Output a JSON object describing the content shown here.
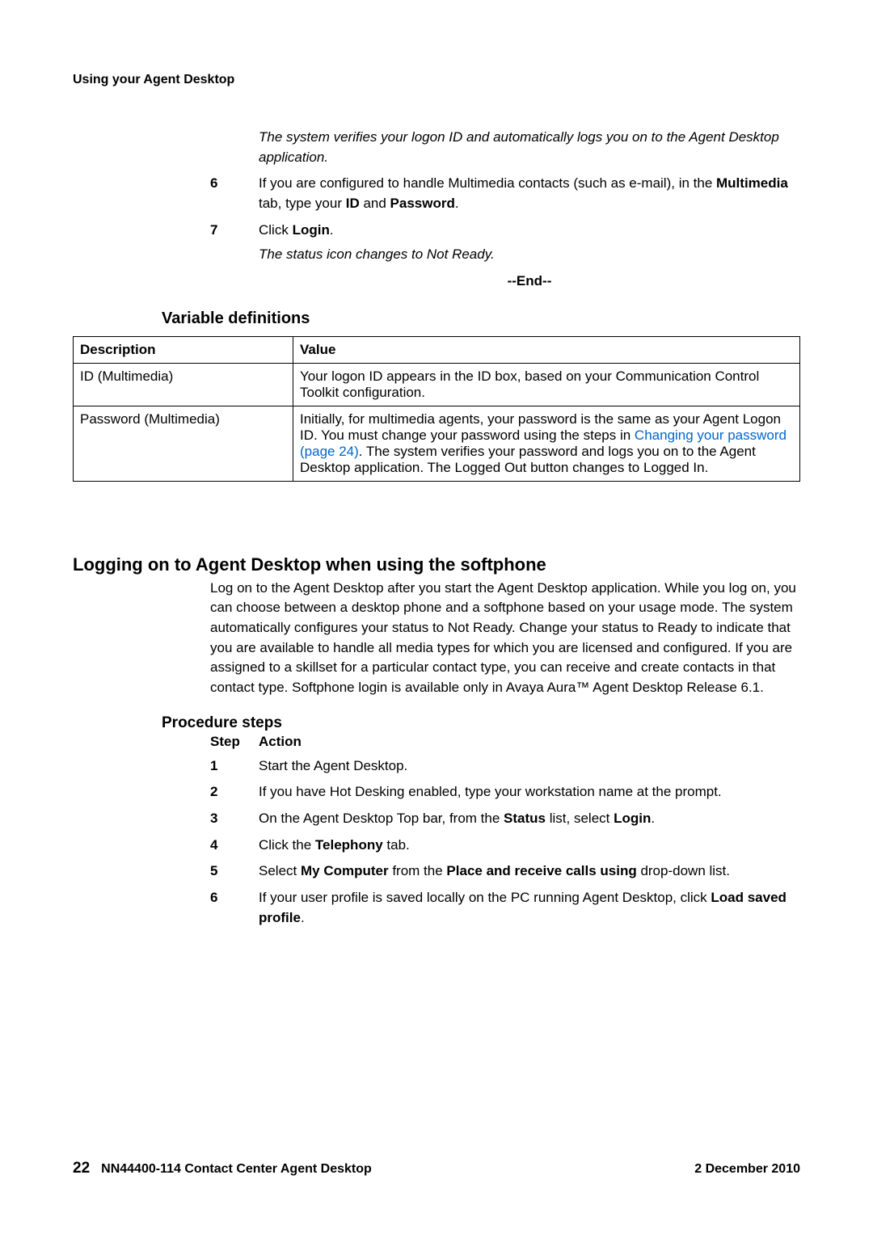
{
  "runningHead": "Using your Agent Desktop",
  "topResult": "The system verifies your logon ID and automatically logs you on to the Agent Desktop application.",
  "steps_top": [
    {
      "num": "6",
      "parts": [
        {
          "t": "If you are configured to handle Multimedia contacts (such as e-mail), in the "
        },
        {
          "t": "Multimedia",
          "b": true
        },
        {
          "t": " tab, type your "
        },
        {
          "t": "ID",
          "b": true
        },
        {
          "t": " and "
        },
        {
          "t": "Password",
          "b": true
        },
        {
          "t": "."
        }
      ]
    },
    {
      "num": "7",
      "parts": [
        {
          "t": "Click "
        },
        {
          "t": "Login",
          "b": true
        },
        {
          "t": "."
        }
      ],
      "result": "The status icon changes to Not Ready."
    }
  ],
  "endMarker": "--End--",
  "varDefHeading": "Variable definitions",
  "table": {
    "headers": [
      "Description",
      "Value"
    ],
    "rows": [
      {
        "desc": "ID (Multimedia)",
        "value_parts": [
          {
            "t": "Your logon ID appears in the ID box, based on your Communication Control Toolkit configuration."
          }
        ]
      },
      {
        "desc": "Password (Multimedia)",
        "value_parts": [
          {
            "t": "Initially, for multimedia agents, your password is the same as your Agent Logon ID. You must change your password using the steps in "
          },
          {
            "t": "Changing your password (page 24)",
            "link": true
          },
          {
            "t": ". The system verifies your password and logs you on to the Agent Desktop application. The Logged Out button changes to Logged In."
          }
        ]
      }
    ]
  },
  "sectionTitle": "Logging on to Agent Desktop when using the softphone",
  "sectionBody": "Log on to the Agent Desktop after you start the Agent Desktop application. While you log on, you can choose between a desktop phone and a softphone based on your usage mode. The system automatically configures your status to Not Ready. Change your status to Ready to indicate that you are available to handle all media types for which you are licensed and configured. If you are assigned to a skillset for a particular contact type, you can receive and create contacts in that contact type. Softphone login is available only in Avaya Aura™ Agent Desktop Release 6.1.",
  "procHeading": "Procedure steps",
  "colHeads": {
    "c1": "Step",
    "c2": "Action"
  },
  "steps_proc": [
    {
      "num": "1",
      "parts": [
        {
          "t": "Start the Agent Desktop."
        }
      ]
    },
    {
      "num": "2",
      "parts": [
        {
          "t": "If you have Hot Desking enabled, type your workstation name at the prompt."
        }
      ]
    },
    {
      "num": "3",
      "parts": [
        {
          "t": "On the Agent Desktop Top bar, from the "
        },
        {
          "t": "Status",
          "b": true
        },
        {
          "t": " list, select "
        },
        {
          "t": "Login",
          "b": true
        },
        {
          "t": "."
        }
      ]
    },
    {
      "num": "4",
      "parts": [
        {
          "t": "Click the "
        },
        {
          "t": "Telephony",
          "b": true
        },
        {
          "t": " tab."
        }
      ]
    },
    {
      "num": "5",
      "parts": [
        {
          "t": "Select "
        },
        {
          "t": "My Computer",
          "b": true
        },
        {
          "t": " from the "
        },
        {
          "t": "Place and receive calls using",
          "b": true
        },
        {
          "t": " drop-down list."
        }
      ]
    },
    {
      "num": "6",
      "parts": [
        {
          "t": "If your user profile is saved locally on the PC running Agent Desktop, click "
        },
        {
          "t": "Load saved profile",
          "b": true
        },
        {
          "t": "."
        }
      ]
    }
  ],
  "footer": {
    "pageNum": "22",
    "docId": "NN44400-114 Contact Center Agent Desktop",
    "date": "2 December 2010"
  }
}
